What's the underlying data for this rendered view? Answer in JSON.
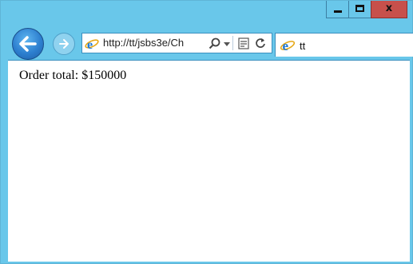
{
  "browser": {
    "address_url": "http://tt/jsbs3e/Ch",
    "tab_title": "tt",
    "caption": {
      "close_label": "x"
    },
    "icons": {
      "back": "back-arrow-icon",
      "forward": "forward-arrow-icon",
      "page": "internet-explorer-icon",
      "search": "search-icon",
      "dropdown": "chevron-down-icon",
      "compat": "compatibility-view-icon",
      "refresh": "refresh-icon"
    },
    "colors": {
      "frame": "#69c7ea",
      "close": "#c7504b",
      "back_button": "#2d7fcf"
    }
  },
  "page": {
    "order_text": "Order total: $150000"
  }
}
